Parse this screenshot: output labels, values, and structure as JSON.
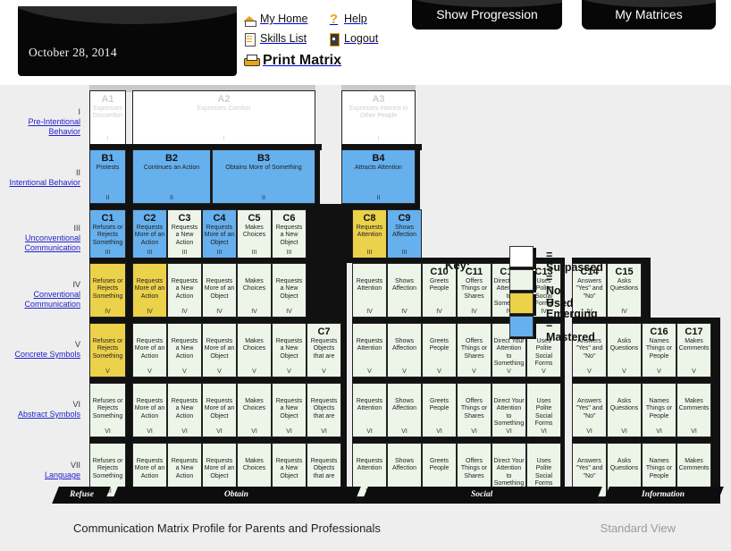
{
  "header": {
    "date": "October 28, 2014",
    "nav": [
      {
        "icon": "home-icon",
        "label": "My Home"
      },
      {
        "icon": "help-icon",
        "label": "Help"
      },
      {
        "icon": "document-icon",
        "label": "Skills List"
      },
      {
        "icon": "logout-icon",
        "label": "Logout"
      }
    ],
    "print": {
      "icon": "printer-icon",
      "label": "Print Matrix"
    },
    "buttons": [
      {
        "label": "Show Progression"
      },
      {
        "label": "My Matrices"
      }
    ]
  },
  "key": {
    "title": "Key:",
    "items": [
      {
        "label": "= Surpassed",
        "color": "#ffffff"
      },
      {
        "label": "= Not Used",
        "color": "#edf5e9"
      },
      {
        "label": "= Emerging",
        "color": "#ecd14b"
      },
      {
        "label": "= Mastered",
        "color": "#66b0ee"
      }
    ]
  },
  "rows": [
    {
      "num": "I",
      "name": "Pre-Intentional Behavior"
    },
    {
      "num": "II",
      "name": "Intentional Behavior"
    },
    {
      "num": "III",
      "name": "Unconventional Communication"
    },
    {
      "num": "IV",
      "name": "Conventional Communication"
    },
    {
      "num": "V",
      "name": "Concrete Symbols"
    },
    {
      "num": "VI",
      "name": "Abstract Symbols"
    },
    {
      "num": "VII",
      "name": "Language"
    }
  ],
  "categories": [
    {
      "label": "Refuse"
    },
    {
      "label": "Obtain"
    },
    {
      "label": "Social"
    },
    {
      "label": "Information"
    }
  ],
  "cells": [
    {
      "code": "A1",
      "desc": "Expresses Discomfort",
      "level": "I",
      "state": "surpassed"
    },
    {
      "code": "A2",
      "desc": "Expresses Comfort",
      "level": "I",
      "state": "surpassed"
    },
    {
      "code": "A3",
      "desc": "Expresses Interest in Other People",
      "level": "I",
      "state": "surpassed"
    },
    {
      "code": "B1",
      "desc": "Protests",
      "level": "II",
      "state": "mastered"
    },
    {
      "code": "B2",
      "desc": "Continues an Action",
      "level": "II",
      "state": "mastered"
    },
    {
      "code": "B3",
      "desc": "Obtains More of Something",
      "level": "II",
      "state": "mastered"
    },
    {
      "code": "B4",
      "desc": "Attracts Attention",
      "level": "II",
      "state": "mastered"
    },
    {
      "code": "C1",
      "desc": "Refuses or Rejects Something",
      "level": "III",
      "state": "mastered"
    },
    {
      "code": "C2",
      "desc": "Requests More of an Action",
      "level": "III",
      "state": "mastered"
    },
    {
      "code": "C3",
      "desc": "Requests a New Action",
      "level": "III",
      "state": "notused"
    },
    {
      "code": "C4",
      "desc": "Requests More of an Object",
      "level": "III",
      "state": "mastered"
    },
    {
      "code": "C5",
      "desc": "Makes Choices",
      "level": "III",
      "state": "notused"
    },
    {
      "code": "C6",
      "desc": "Requests a New Object",
      "level": "III",
      "state": "notused"
    },
    {
      "code": "C8",
      "desc": "Requests Attention",
      "level": "III",
      "state": "emerging"
    },
    {
      "code": "C9",
      "desc": "Shows Affection",
      "level": "III",
      "state": "mastered"
    },
    {
      "code": "",
      "desc": "Refuses or Rejects Something",
      "level": "IV",
      "state": "emerging"
    },
    {
      "code": "",
      "desc": "Requests More of an Action",
      "level": "IV",
      "state": "emerging"
    },
    {
      "code": "",
      "desc": "Requests a New Action",
      "level": "IV",
      "state": "notused"
    },
    {
      "code": "",
      "desc": "Requests More of an Object",
      "level": "IV",
      "state": "notused"
    },
    {
      "code": "",
      "desc": "Makes Choices",
      "level": "IV",
      "state": "notused"
    },
    {
      "code": "",
      "desc": "Requests a New Object",
      "level": "IV",
      "state": "notused"
    },
    {
      "code": "",
      "desc": "Requests Attention",
      "level": "IV",
      "state": "notused"
    },
    {
      "code": "",
      "desc": "Shows Affection",
      "level": "IV",
      "state": "notused"
    },
    {
      "code": "C10",
      "desc": "Greets People",
      "level": "IV",
      "state": "notused"
    },
    {
      "code": "C11",
      "desc": "Offers Things or Shares",
      "level": "IV",
      "state": "notused"
    },
    {
      "code": "C12",
      "desc": "Direct Your Attention to Something",
      "level": "IV",
      "state": "notused"
    },
    {
      "code": "C13",
      "desc": "Uses Polite Social Forms",
      "level": "IV",
      "state": "notused"
    },
    {
      "code": "C14",
      "desc": "Answers \"Yes\" and \"No\"",
      "level": "IV",
      "state": "notused"
    },
    {
      "code": "C15",
      "desc": "Asks Questions",
      "level": "IV",
      "state": "notused"
    },
    {
      "code": "",
      "desc": "Refuses or Rejects Something",
      "level": "V",
      "state": "emerging"
    },
    {
      "code": "",
      "desc": "Requests More of an Object",
      "level": "V",
      "state": "notused"
    },
    {
      "code": "C7",
      "desc": "Requests Objects that are",
      "level": "V",
      "state": "notused"
    },
    {
      "code": "C16",
      "desc": "Names Things or People",
      "level": "V",
      "state": "notused"
    },
    {
      "code": "C17",
      "desc": "Makes Comments",
      "level": "V",
      "state": "notused"
    }
  ],
  "grid": {
    "obtain_cols": [
      "Requests More of an Action",
      "Requests a New Action",
      "Requests More of an Object",
      "Makes Choices",
      "Requests a New Object",
      "Requests Objects that are"
    ],
    "refuse_col": "Refuses or Rejects Something",
    "social_cols": [
      "Requests Attention",
      "Shows Affection",
      "Greets People",
      "Offers Things or Shares",
      "Direct Your Attention to Something",
      "Uses Polite Social Forms"
    ],
    "info_cols": [
      "Answers \"Yes\" and \"No\"",
      "Asks Questions",
      "Names Things or People",
      "Makes Comments"
    ]
  },
  "footer": {
    "title": "Communication Matrix Profile for Parents and Professionals",
    "view": "Standard View"
  }
}
